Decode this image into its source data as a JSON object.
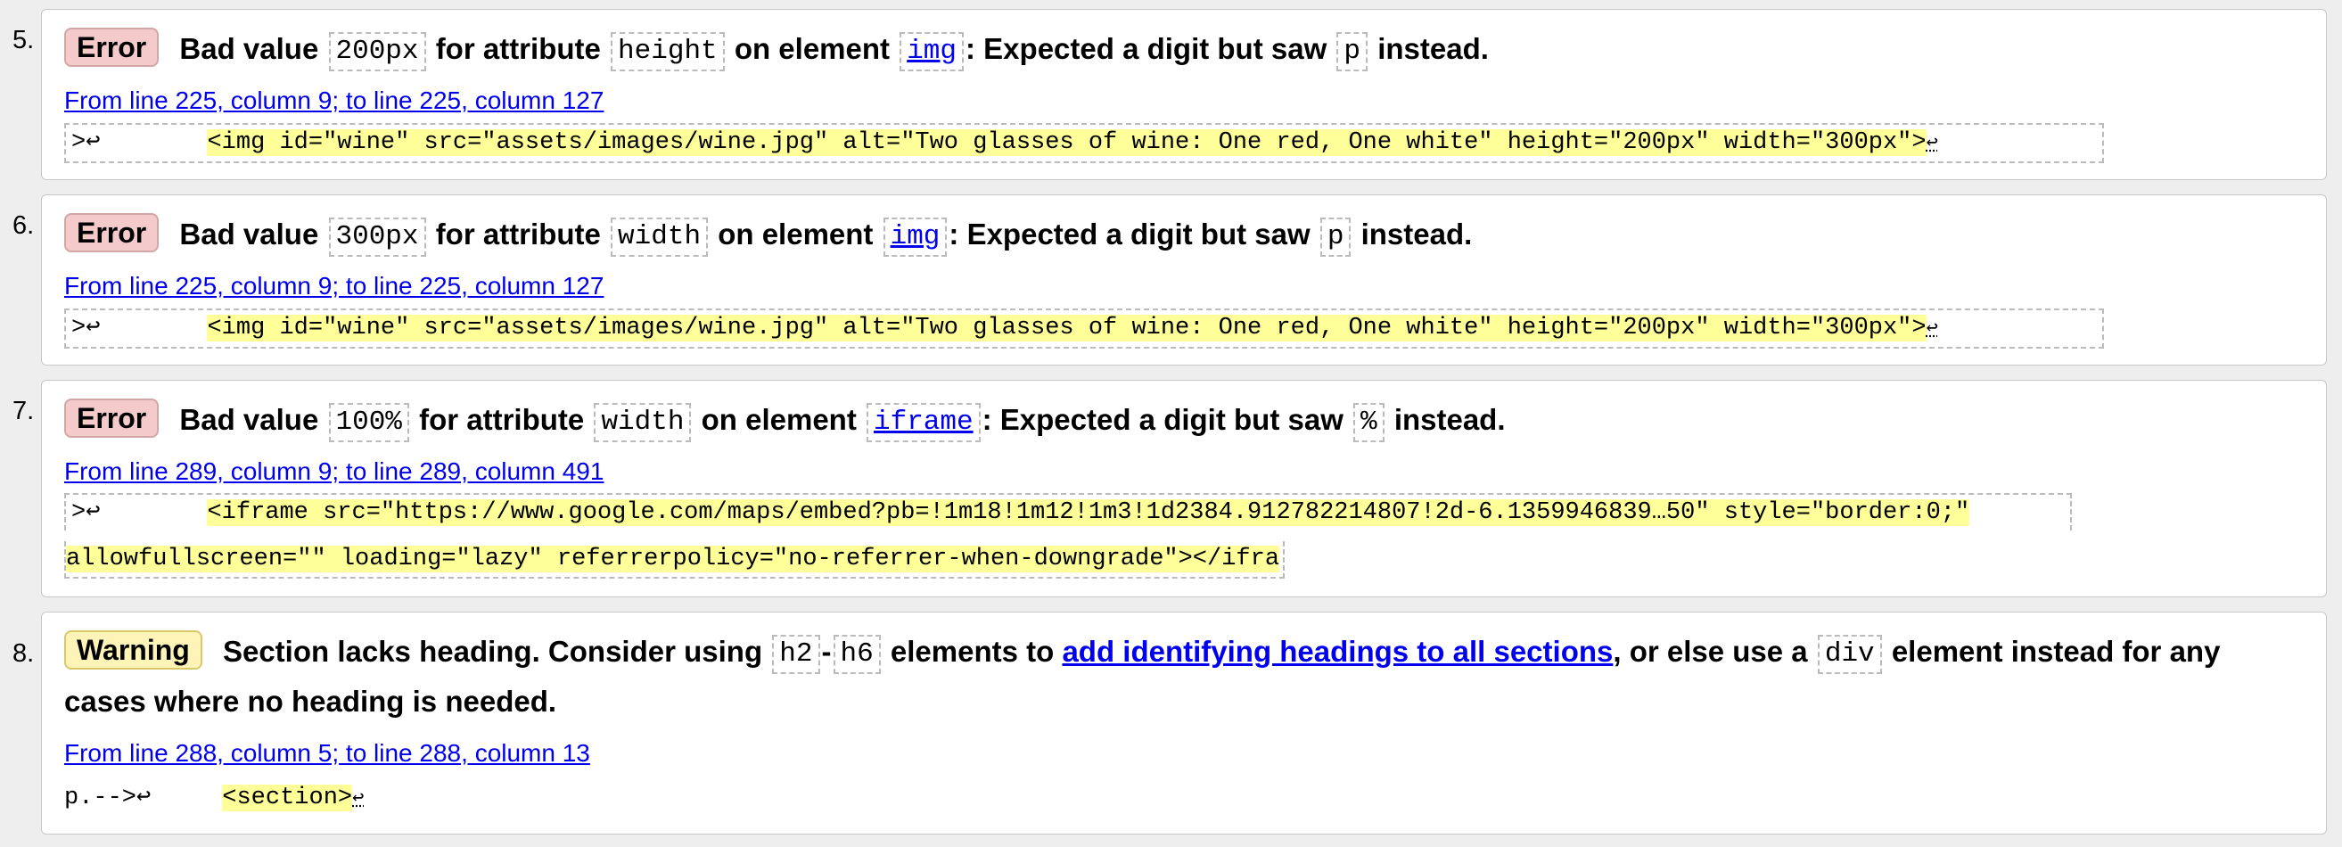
{
  "messages": [
    {
      "number": "5.",
      "type": "Error",
      "parts": [
        "Bad value",
        "200px",
        "for attribute",
        "height",
        "on element",
        "img",
        ": Expected a digit but saw",
        "p",
        "instead."
      ],
      "location": "From line 225, column 9; to line 225, column 127",
      "extract_prefix": ">↩",
      "extract_code": "<img id=\"wine\" src=\"assets/images/wine.jpg\" alt=\"Two glasses of wine: One red, One white\" height=\"200px\" width=\"300px\">",
      "extract_suffix": "↩"
    },
    {
      "number": "6.",
      "type": "Error",
      "parts": [
        "Bad value",
        "300px",
        "for attribute",
        "width",
        "on element",
        "img",
        ": Expected a digit but saw",
        "p",
        "instead."
      ],
      "location": "From line 225, column 9; to line 225, column 127",
      "extract_prefix": ">↩",
      "extract_code": "<img id=\"wine\" src=\"assets/images/wine.jpg\" alt=\"Two glasses of wine: One red, One white\" height=\"200px\" width=\"300px\">",
      "extract_suffix": "↩"
    },
    {
      "number": "7.",
      "type": "Error",
      "parts": [
        "Bad value",
        "100%",
        "for attribute",
        "width",
        "on element",
        "iframe",
        ": Expected a digit but saw",
        "%",
        "instead."
      ],
      "location": "From line 289, column 9; to line 289, column 491",
      "extract_prefix": ">↩",
      "extract_code_line1": "<iframe src=\"https://www.google.com/maps/embed?pb=!1m18!1m12!1m3!1d2384.912782214807!2d-6.1359946839…50\" style=\"border:0;\"",
      "extract_code_line2": "allowfullscreen=\"\" loading=\"lazy\" referrerpolicy=\"no-referrer-when-downgrade\"></ifra"
    },
    {
      "number": "8.",
      "type": "Warning",
      "text_before": "Section lacks heading. Consider using",
      "code1": "h2",
      "dash": "-",
      "code2": "h6",
      "text_mid": "elements to",
      "link_text": "add identifying headings to all sections",
      "text_after": ", or else use a",
      "code3": "div",
      "text_end": "element instead for any cases where no heading is needed.",
      "location": "From line 288, column 5; to line 288, column 13",
      "extract_prefix": "p.-->↩",
      "extract_code": "<section>",
      "extract_suffix": "↩"
    }
  ],
  "colors": {
    "error_badge": "#f4caca",
    "warning_badge": "#fff4b8",
    "highlight": "#ffff99",
    "link": "#0000ee"
  }
}
